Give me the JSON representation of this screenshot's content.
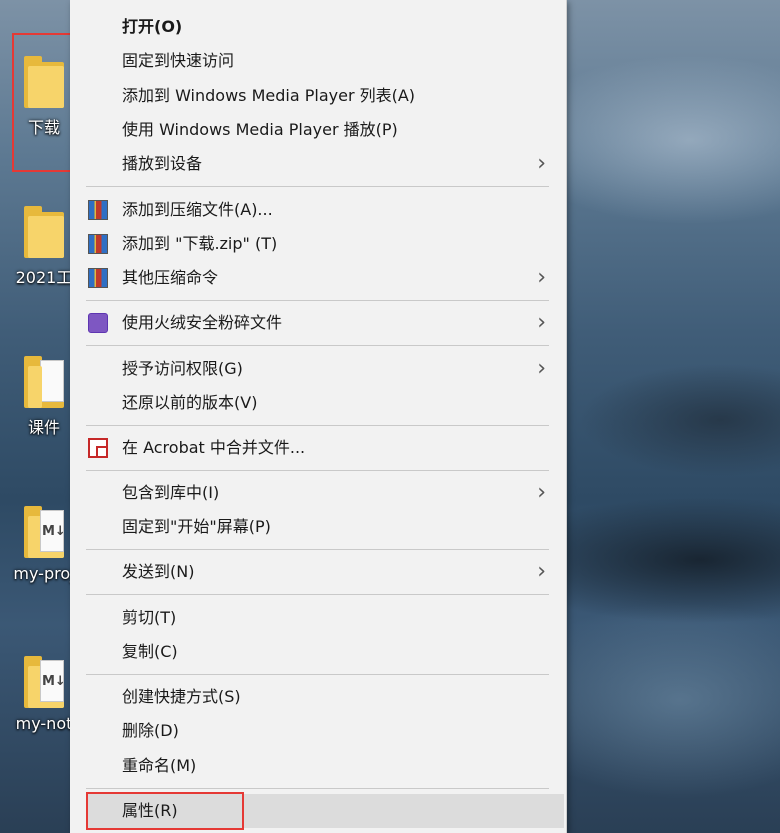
{
  "desktop": {
    "icons": [
      {
        "label": "下载"
      },
      {
        "label": "2021工"
      },
      {
        "label": "课件"
      },
      {
        "label": "my-proj",
        "mark": "M↓"
      },
      {
        "label": "my-not",
        "mark": "M↓"
      }
    ]
  },
  "context_menu": {
    "items": [
      {
        "label": "打开(O)",
        "bold": true
      },
      {
        "label": "固定到快速访问"
      },
      {
        "label": "添加到 Windows Media Player 列表(A)"
      },
      {
        "label": "使用 Windows Media Player 播放(P)"
      },
      {
        "label": "播放到设备",
        "submenu": true
      },
      {
        "label": "添加到压缩文件(A)...",
        "icon": "winrar-icon"
      },
      {
        "label": "添加到 \"下载.zip\" (T)",
        "icon": "winrar-icon"
      },
      {
        "label": "其他压缩命令",
        "icon": "winrar-icon",
        "submenu": true
      },
      {
        "label": "使用火绒安全粉碎文件",
        "icon": "shredder-icon",
        "submenu": true
      },
      {
        "label": "授予访问权限(G)",
        "submenu": true
      },
      {
        "label": "还原以前的版本(V)"
      },
      {
        "label": "在 Acrobat 中合并文件...",
        "icon": "acrobat-icon"
      },
      {
        "label": "包含到库中(I)",
        "submenu": true
      },
      {
        "label": "固定到\"开始\"屏幕(P)"
      },
      {
        "label": "发送到(N)",
        "submenu": true
      },
      {
        "label": "剪切(T)"
      },
      {
        "label": "复制(C)"
      },
      {
        "label": "创建快捷方式(S)"
      },
      {
        "label": "删除(D)"
      },
      {
        "label": "重命名(M)"
      },
      {
        "label": "属性(R)",
        "highlighted": true
      }
    ],
    "submenu_glyph": "›"
  },
  "colors": {
    "menu_bg": "#f2f2f2",
    "highlight_bg": "#dcdcdc",
    "annotation_red": "#e53935"
  }
}
